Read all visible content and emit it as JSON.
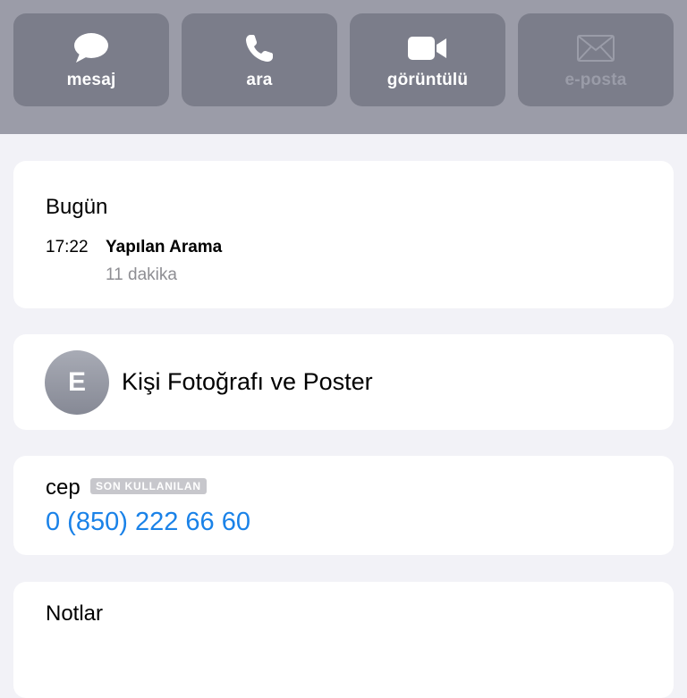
{
  "actions": [
    {
      "label": "mesaj",
      "icon": "message-bubble-icon",
      "enabled": true
    },
    {
      "label": "ara",
      "icon": "phone-icon",
      "enabled": true
    },
    {
      "label": "görüntülü",
      "icon": "video-camera-icon",
      "enabled": true
    },
    {
      "label": "e-posta",
      "icon": "envelope-icon",
      "enabled": false
    }
  ],
  "recents": {
    "title": "Bugün",
    "items": [
      {
        "time": "17:22",
        "type": "Yapılan Arama",
        "duration": "11 dakika"
      }
    ]
  },
  "contact_photo": {
    "initial": "E",
    "label": "Kişi Fotoğrafı ve Poster"
  },
  "phone": {
    "label": "cep",
    "badge": "SON KULLANILAN",
    "number": "0 (850) 222 66 60"
  },
  "notes": {
    "title": "Notlar"
  },
  "colors": {
    "accent": "#1a82e8",
    "top_bar": "#9b9ca8",
    "action_button": "#7b7d8a",
    "background": "#f2f2f7"
  }
}
